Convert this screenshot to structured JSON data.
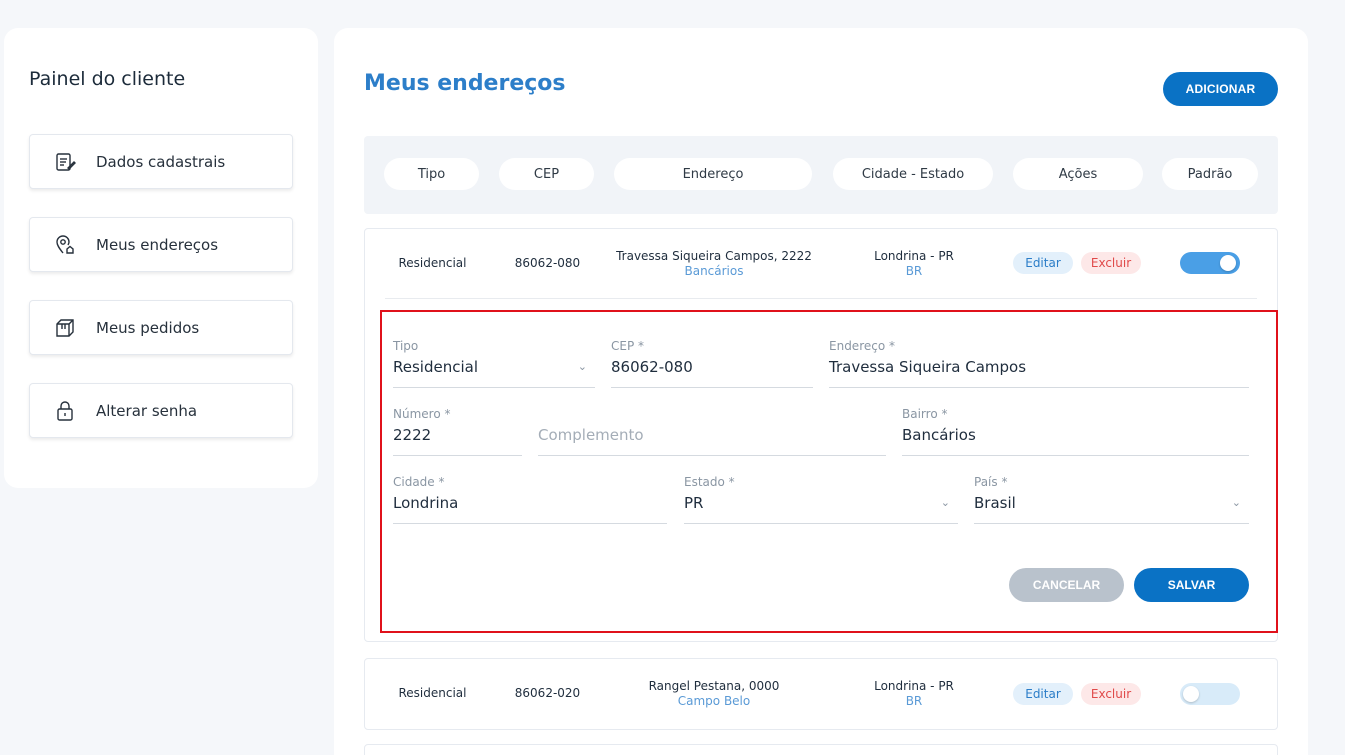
{
  "sidebar": {
    "title": "Painel do cliente",
    "items": [
      {
        "label": "Dados cadastrais",
        "icon": "profile-form-icon"
      },
      {
        "label": "Meus endereços",
        "icon": "map-pin-icon"
      },
      {
        "label": "Meus pedidos",
        "icon": "box-icon"
      },
      {
        "label": "Alterar senha",
        "icon": "lock-icon"
      }
    ]
  },
  "main": {
    "title": "Meus endereços",
    "add_label": "ADICIONAR",
    "columns": [
      "Tipo",
      "CEP",
      "Endereço",
      "Cidade - Estado",
      "Ações",
      "Padrão"
    ],
    "rows": [
      {
        "tipo": "Residencial",
        "cep": "86062-080",
        "endereco": "Travessa Siqueira Campos, 2222",
        "bairro": "Bancários",
        "cidade": "Londrina - PR",
        "pais": "BR",
        "edit": "Editar",
        "delete": "Excluir",
        "default": true
      },
      {
        "tipo": "Residencial",
        "cep": "86062-020",
        "endereco": "Rangel Pestana, 0000",
        "bairro": "Campo Belo",
        "cidade": "Londrina - PR",
        "pais": "BR",
        "edit": "Editar",
        "delete": "Excluir",
        "default": false
      }
    ]
  },
  "form": {
    "tipo": {
      "label": "Tipo",
      "value": "Residencial"
    },
    "cep": {
      "label": "CEP *",
      "value": "86062-080"
    },
    "endereco": {
      "label": "Endereço *",
      "value": "Travessa Siqueira Campos"
    },
    "numero": {
      "label": "Número *",
      "value": "2222"
    },
    "complemento": {
      "placeholder": "Complemento"
    },
    "bairro": {
      "label": "Bairro *",
      "value": "Bancários"
    },
    "cidade": {
      "label": "Cidade *",
      "value": "Londrina"
    },
    "estado": {
      "label": "Estado *",
      "value": "PR"
    },
    "pais": {
      "label": "País *",
      "value": "Brasil"
    },
    "cancel_label": "CANCELAR",
    "save_label": "SALVAR"
  },
  "colors": {
    "accent": "#0a72c5",
    "title": "#2c7ec9",
    "highlight": "#e0111b"
  }
}
